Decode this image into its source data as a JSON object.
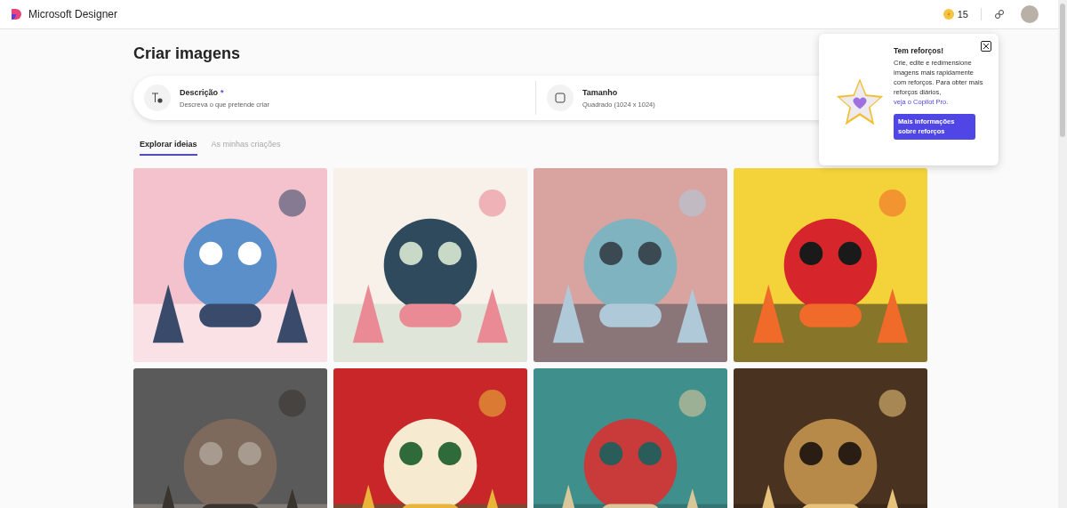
{
  "header": {
    "app_name": "Microsoft Designer",
    "credits": "15"
  },
  "page": {
    "title": "Criar imagens"
  },
  "prompt": {
    "fields": [
      {
        "kind": "description",
        "label": "Descrição",
        "required_mark": "*",
        "placeholder": "Descreva o que pretende criar"
      },
      {
        "kind": "size",
        "label": "Tamanho",
        "value": "Quadrado (1024 x 1024)"
      }
    ]
  },
  "tabs": [
    {
      "label": "Explorar ideias",
      "selected": true
    },
    {
      "label": "As minhas criações",
      "selected": false
    }
  ],
  "popover": {
    "title": "Tem reforços!",
    "body": "Crie, edite e redimensione imagens mais rapidamente com reforços. Para obter mais reforços diários,",
    "link": "veja o Copilot Pro.",
    "button": "Mais informações sobre reforços"
  }
}
